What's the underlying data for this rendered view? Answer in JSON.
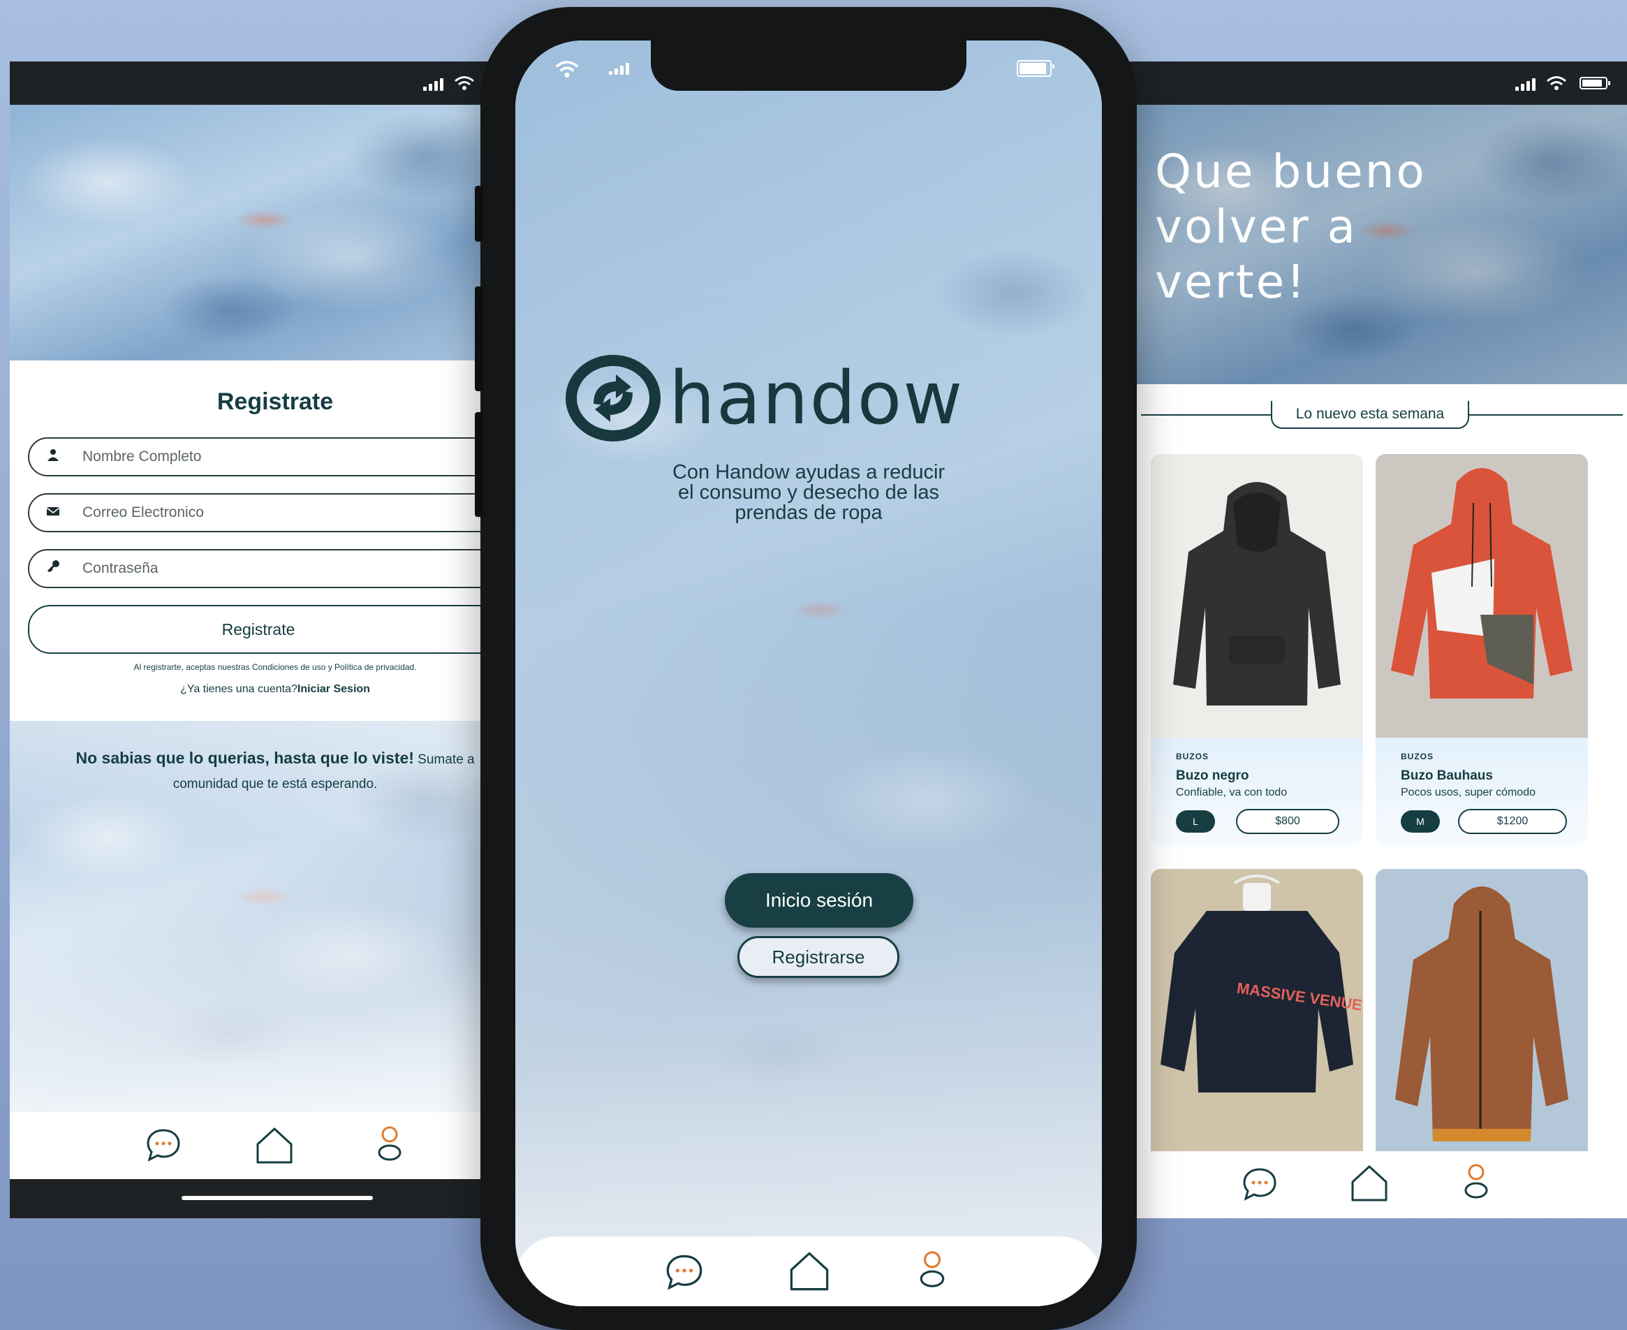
{
  "left_screen": {
    "title": "Registrate",
    "fields": [
      {
        "placeholder": "Nombre Completo",
        "icon": "user-icon"
      },
      {
        "placeholder": "Correo Electronico",
        "icon": "envelope-icon"
      },
      {
        "placeholder": "Contraseña",
        "icon": "key-icon"
      }
    ],
    "submit_label": "Registrate",
    "terms_text": "Al registrarte, aceptas nuestras Condiciones de uso y Política de privacidad.",
    "login_prompt": "¿Ya tienes una cuenta?",
    "login_link": "Iniciar Sesion",
    "promo_bold": "No sabias que lo querias, hasta que lo viste!",
    "promo_rest_line1": " Sumate a",
    "promo_line2": "comunidad que te está esperando."
  },
  "center_screen": {
    "brand": "handow",
    "tagline_lines": [
      "Con Handow ayudas a reducir",
      "el consumo y desecho de las",
      "prendas de ropa"
    ],
    "login_button": "Inicio sesión",
    "register_button": "Registrarse"
  },
  "right_screen": {
    "greeting_lines": [
      "Que bueno",
      "volver a",
      "verte!"
    ],
    "section_label": "Lo nuevo esta semana",
    "products": [
      {
        "category": "BUZOS",
        "name": "Buzo negro",
        "description": "Confiable, va con todo",
        "size": "L",
        "price": "$800"
      },
      {
        "category": "BUZOS",
        "name": "Buzo Bauhaus",
        "description": "Pocos usos, super cómodo",
        "size": "M",
        "price": "$1200"
      }
    ],
    "sweatshirt_print": "MASSIVE VENUE"
  },
  "nav": {
    "items": [
      "chat-icon",
      "home-icon",
      "profile-icon"
    ]
  },
  "colors": {
    "primary": "#153d42",
    "accent": "#e07b2e",
    "background": "#9db3d8"
  }
}
